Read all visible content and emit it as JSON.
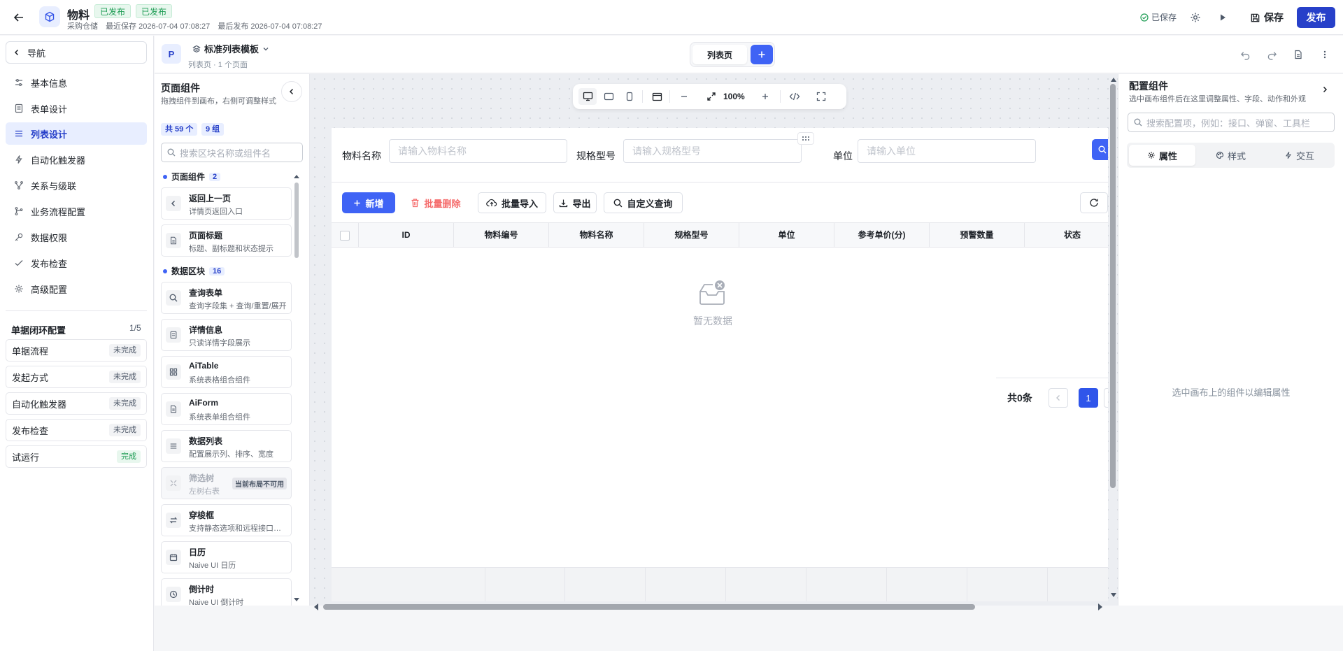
{
  "topbar": {
    "title": "物料",
    "tags": [
      "已发布",
      "已发布"
    ],
    "meta": {
      "warehouse": "采购仓储",
      "last_saved": "最近保存 2026-07-04 07:08:27",
      "last_published": "最后发布 2026-07-04 07:08:27"
    },
    "saved_status": "已保存",
    "save_label": "保存",
    "publish_label": "发布"
  },
  "leftnav": {
    "toggle_label": "导航",
    "items": [
      {
        "label": "基本信息",
        "icon": "sliders-icon"
      },
      {
        "label": "表单设计",
        "icon": "form-icon"
      },
      {
        "label": "列表设计",
        "icon": "list-icon",
        "active": true
      },
      {
        "label": "自动化触发器",
        "icon": "bolt-icon"
      },
      {
        "label": "关系与级联",
        "icon": "relation-icon"
      },
      {
        "label": "业务流程配置",
        "icon": "flow-icon"
      },
      {
        "label": "数据权限",
        "icon": "key-icon"
      },
      {
        "label": "发布检查",
        "icon": "check-icon"
      },
      {
        "label": "高级配置",
        "icon": "gear-icon"
      }
    ],
    "loop": {
      "title": "单据闭环配置",
      "count": "1/5",
      "items": [
        {
          "label": "单据流程",
          "status": "未完成",
          "done": false
        },
        {
          "label": "发起方式",
          "status": "未完成",
          "done": false
        },
        {
          "label": "自动化触发器",
          "status": "未完成",
          "done": false
        },
        {
          "label": "发布检查",
          "status": "未完成",
          "done": false
        },
        {
          "label": "试运行",
          "status": "完成",
          "done": true
        }
      ]
    }
  },
  "subheader": {
    "avatar": "P",
    "template_name": "标准列表模板",
    "template_meta": "列表页 · 1 个页面",
    "tab_label": "列表页"
  },
  "components": {
    "title": "页面组件",
    "desc": "拖拽组件到画布，右侧可调整样式",
    "total": "共 59 个",
    "groups": "9 组",
    "search_placeholder": "搜索区块名称或组件名",
    "group1": {
      "label": "页面组件",
      "count": "2"
    },
    "group2": {
      "label": "数据区块",
      "count": "16"
    },
    "cards": [
      {
        "name": "返回上一页",
        "desc": "详情页返回入口",
        "icon": "chevron-left-icon"
      },
      {
        "name": "页面标题",
        "desc": "标题、副标题和状态提示",
        "icon": "document-icon"
      },
      {
        "name": "查询表单",
        "desc": "查询字段集 + 查询/重置/展开",
        "icon": "search-icon"
      },
      {
        "name": "详情信息",
        "desc": "只读详情字段展示",
        "icon": "detail-icon"
      },
      {
        "name": "AiTable",
        "desc": "系统表格组合组件",
        "icon": "grid-icon"
      },
      {
        "name": "AiForm",
        "desc": "系统表单组合组件",
        "icon": "document-icon"
      },
      {
        "name": "数据列表",
        "desc": "配置展示列、排序、宽度",
        "icon": "list-icon"
      },
      {
        "name": "筛选树",
        "desc": "左树右表",
        "icon": "tree-icon",
        "disabled": true,
        "badge": "当前布局不可用"
      },
      {
        "name": "穿梭框",
        "desc": "支持静态选项和远程接口数据",
        "icon": "swap-icon"
      },
      {
        "name": "日历",
        "desc": "Naive UI 日历",
        "icon": "calendar-icon"
      },
      {
        "name": "倒计时",
        "desc": "Naive UI 倒计时",
        "icon": "clock-icon"
      }
    ]
  },
  "canvas": {
    "zoom": "100%",
    "query": [
      {
        "label": "物料名称",
        "placeholder": "请输入物料名称"
      },
      {
        "label": "规格型号",
        "placeholder": "请输入规格型号"
      },
      {
        "label": "单位",
        "placeholder": "请输入单位"
      }
    ],
    "actions": {
      "add": "新增",
      "batch_delete": "批量删除",
      "batch_import": "批量导入",
      "export": "导出",
      "custom_query": "自定义查询"
    },
    "columns": [
      "ID",
      "物料编号",
      "物料名称",
      "规格型号",
      "单位",
      "参考单价(分)",
      "预警数量",
      "状态"
    ],
    "empty_text": "暂无数据",
    "pagination": {
      "total": "共0条",
      "page": "1"
    }
  },
  "config": {
    "title": "配置组件",
    "desc": "选中画布组件后在这里调整属性、字段、动作和外观",
    "search_placeholder": "搜索配置项，例如：接口、弹窗、工具栏",
    "tabs": [
      "属性",
      "样式",
      "交互"
    ],
    "empty": "选中画布上的组件以编辑属性"
  },
  "colors": {
    "primary": "#3f63f5",
    "publish": "#2740c9",
    "danger": "#f56c6c",
    "success": "#1f9d55"
  }
}
